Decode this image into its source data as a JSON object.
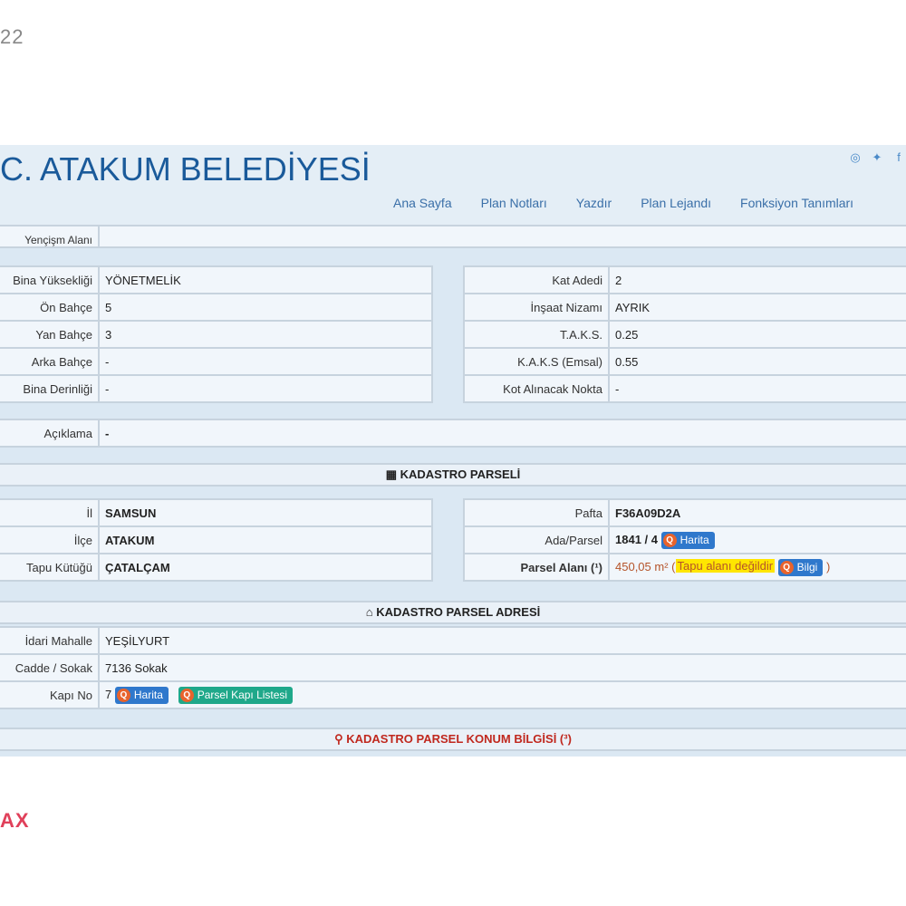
{
  "corner_number": "22",
  "corner_watermark": "AX",
  "header": {
    "title": "C. ATAKUM BELEDİYESİ",
    "menu": [
      "Ana Sayfa",
      "Plan Notları",
      "Yazdır",
      "Plan Lejandı",
      "Fonksiyon Tanımları"
    ]
  },
  "top_partial_label": "Yençişm Alanı",
  "left_table": [
    {
      "label": "Bina Yüksekliği",
      "value": "YÖNETMELİK"
    },
    {
      "label": "Ön Bahçe",
      "value": "5"
    },
    {
      "label": "Yan Bahçe",
      "value": "3"
    },
    {
      "label": "Arka Bahçe",
      "value": "-"
    },
    {
      "label": "Bina Derinliği",
      "value": "-"
    }
  ],
  "right_table": [
    {
      "label": "Kat Adedi",
      "value": "2"
    },
    {
      "label": "İnşaat Nizamı",
      "value": "AYRIK"
    },
    {
      "label": "T.A.K.S.",
      "value": "0.25"
    },
    {
      "label": "K.A.K.S (Emsal)",
      "value": "0.55"
    },
    {
      "label": "Kot Alınacak Nokta",
      "value": "-"
    }
  ],
  "aciklama": {
    "label": "Açıklama",
    "value": "-"
  },
  "kadastro_parseli": {
    "title": "KADASTRO PARSELİ",
    "left": [
      {
        "label": "İl",
        "value": "SAMSUN"
      },
      {
        "label": "İlçe",
        "value": "ATAKUM"
      },
      {
        "label": "Tapu Kütüğü",
        "value": "ÇATALÇAM"
      }
    ],
    "pafta": {
      "label": "Pafta",
      "value": "F36A09D2A"
    },
    "ada_parsel": {
      "label": "Ada/Parsel",
      "value": "1841 / 4",
      "button": "Harita"
    },
    "parsel_alani": {
      "label": "Parsel Alanı (¹)",
      "value": "450,05 m²",
      "note": "Tapu alanı değildir",
      "button": "Bilgi",
      "open_paren": "(",
      "close_paren": ")"
    }
  },
  "kadastro_parsel_adresi": {
    "title": "KADASTRO PARSEL ADRESİ",
    "rows": [
      {
        "label": "İdari Mahalle",
        "value": "YEŞİLYURT"
      },
      {
        "label": "Cadde / Sokak",
        "value": "7136 Sokak"
      }
    ],
    "kapi_no": {
      "label": "Kapı No",
      "value": "7",
      "button1": "Harita",
      "button2": "Parsel Kapı Listesi"
    }
  },
  "konum_bilgisi": {
    "title": "KADASTRO PARSEL KONUM BİLGİSİ (³)"
  },
  "colors": {
    "header_bg": "#e4eef6",
    "title": "#1a5a9a",
    "menu": "#3a6fa8",
    "accent_red": "#c0281e",
    "btn_blue": "#2f78cc",
    "btn_teal": "#1fa88a",
    "btn_icon": "#e8632c",
    "highlight": "#ffe600"
  }
}
